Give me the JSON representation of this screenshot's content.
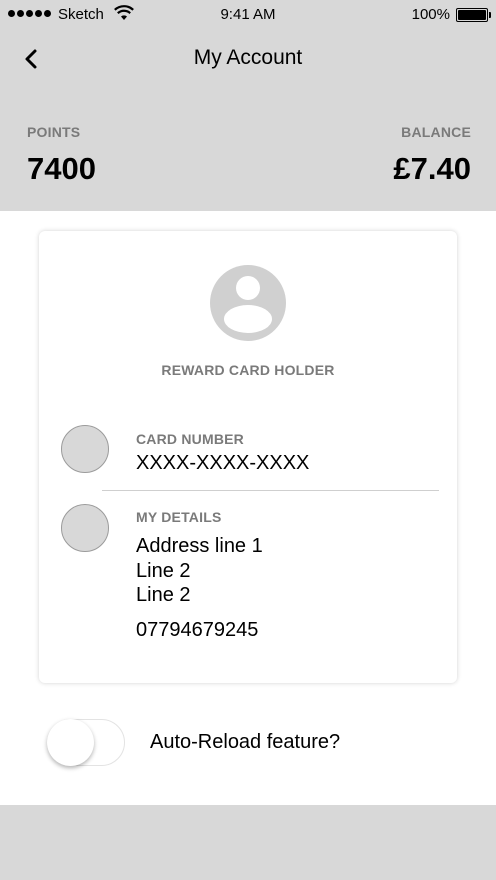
{
  "status_bar": {
    "carrier": "Sketch",
    "time": "9:41 AM",
    "battery": "100%"
  },
  "header": {
    "title": "My Account",
    "points_label": "POINTS",
    "points_value": "7400",
    "balance_label": "BALANCE",
    "balance_value": "£7.40"
  },
  "card": {
    "holder_label": "REWARD CARD HOLDER",
    "card_number": {
      "label": "CARD NUMBER",
      "value": "XXXX-XXXX-XXXX"
    },
    "my_details": {
      "label": "MY DETAILS",
      "address_line_1": "Address line 1",
      "address_line_2": "Line 2",
      "address_line_3": "Line 2",
      "phone": "07794679245"
    }
  },
  "auto_reload": {
    "label": "Auto-Reload feature?",
    "enabled": false
  },
  "icons": [
    "chevron-left-icon",
    "wifi-icon",
    "battery-icon",
    "user-avatar-icon"
  ],
  "colors": {
    "header_bg": "#d8d8d8",
    "label_gray": "#7a7a7a",
    "avatar_gray": "#d0d0d0"
  }
}
